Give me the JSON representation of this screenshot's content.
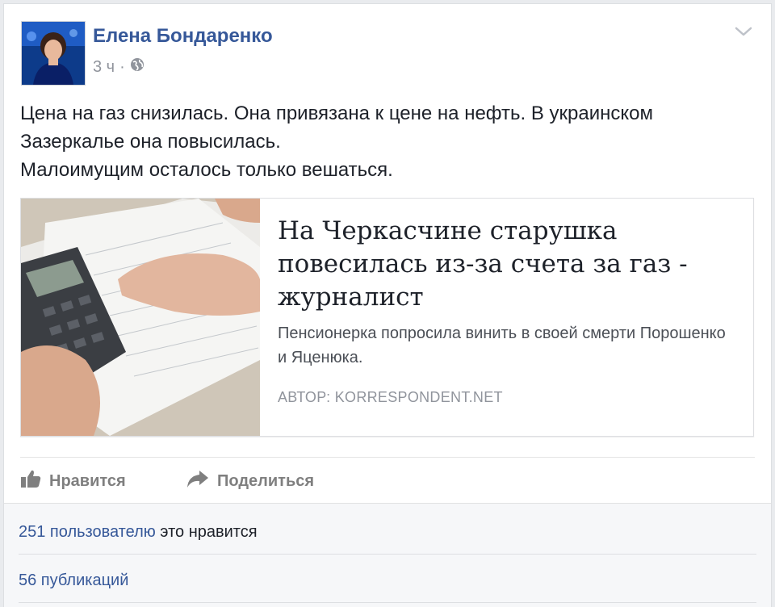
{
  "post": {
    "author": "Елена Бондаренко",
    "time": "3 ч",
    "privacy_separator": "·",
    "privacy_icon": "globe-icon",
    "menu_icon": "chevron-down-icon",
    "text_lines": [
      "Цена на газ снизилась. Она привязана к цене на нефть. В украинском",
      "Зазеркалье она повысилась.",
      "Малоимущим осталось только вешаться."
    ]
  },
  "link": {
    "title": "На Черкасчине старушка повесилась из-за счета за газ - журналист",
    "description": "Пенсионерка попросила винить в своей смерти Порошенко и Яценюка.",
    "source": "АВТОР: KORRESPONDENT.NET"
  },
  "actions": {
    "like_label": "Нравится",
    "like_icon": "thumbs-up-icon",
    "share_label": "Поделиться",
    "share_icon": "share-arrow-icon"
  },
  "footer": {
    "likes_link": "251 пользователю",
    "likes_suffix": " это нравится",
    "shares": "56 публикаций"
  },
  "colors": {
    "link_blue": "#365899",
    "text": "#1d2129",
    "muted": "#90949c"
  }
}
